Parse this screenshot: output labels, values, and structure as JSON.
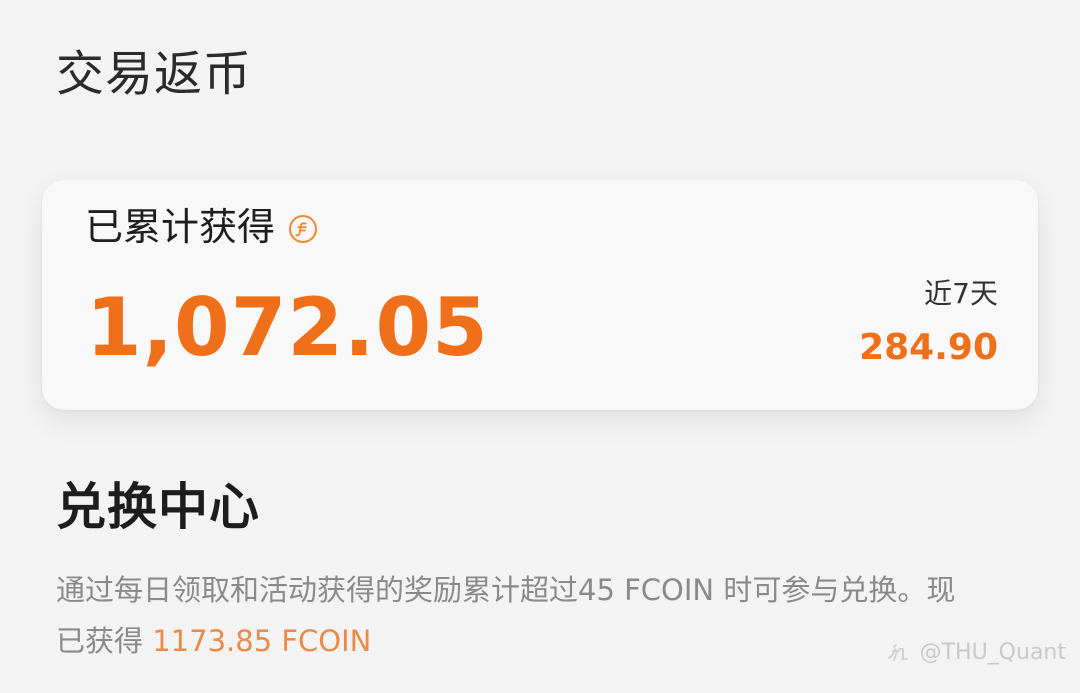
{
  "header": {
    "title": "交易返币"
  },
  "summary_card": {
    "label": "已累计获得",
    "coin_icon": "fcoin-coin-icon",
    "total_value": "1,072.05",
    "recent_label": "近7天",
    "recent_value": "284.90"
  },
  "exchange": {
    "title": "兑换中心",
    "desc_prefix": "通过每日领取和活动获得的奖励累计超过45 FCOIN 时可参与兑换。现已获得 ",
    "desc_highlight": "1173.85 FCOIN"
  },
  "watermark": {
    "icon": "zhihu-style-watermark-icon",
    "text": "@THU_Quant"
  },
  "colors": {
    "accent": "#ef6f1a",
    "background": "#f3f3f3",
    "card_background": "#f8f8f8",
    "muted_text": "#8a8a8a",
    "highlight_text": "#ec8a4a"
  }
}
